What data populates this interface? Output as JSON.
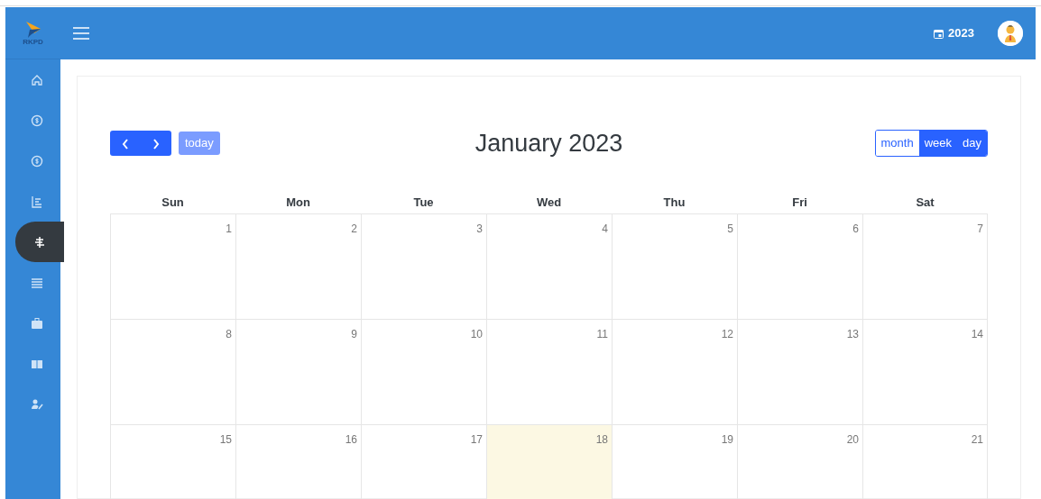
{
  "sidebar": {
    "logo_text": "RKPD",
    "items": [
      {
        "selected": false
      },
      {
        "selected": false
      },
      {
        "selected": false
      },
      {
        "selected": false
      },
      {
        "selected": true
      },
      {
        "selected": false
      },
      {
        "selected": false
      },
      {
        "selected": false
      },
      {
        "selected": false
      }
    ]
  },
  "header": {
    "year": "2023"
  },
  "calendar": {
    "title": "January 2023",
    "today_label": "today",
    "views": [
      {
        "label": "month",
        "selected": true
      },
      {
        "label": "week",
        "selected": false
      },
      {
        "label": "day",
        "selected": false
      }
    ],
    "weekdays": [
      "Sun",
      "Mon",
      "Tue",
      "Wed",
      "Thu",
      "Fri",
      "Sat"
    ],
    "weeks": [
      [
        {
          "day": "1",
          "today": false
        },
        {
          "day": "2",
          "today": false
        },
        {
          "day": "3",
          "today": false
        },
        {
          "day": "4",
          "today": false
        },
        {
          "day": "5",
          "today": false
        },
        {
          "day": "6",
          "today": false
        },
        {
          "day": "7",
          "today": false
        }
      ],
      [
        {
          "day": "8",
          "today": false
        },
        {
          "day": "9",
          "today": false
        },
        {
          "day": "10",
          "today": false
        },
        {
          "day": "11",
          "today": false
        },
        {
          "day": "12",
          "today": false
        },
        {
          "day": "13",
          "today": false
        },
        {
          "day": "14",
          "today": false
        }
      ],
      [
        {
          "day": "15",
          "today": false
        },
        {
          "day": "16",
          "today": false
        },
        {
          "day": "17",
          "today": false
        },
        {
          "day": "18",
          "today": true
        },
        {
          "day": "19",
          "today": false
        },
        {
          "day": "20",
          "today": false
        },
        {
          "day": "21",
          "today": false
        }
      ]
    ]
  }
}
